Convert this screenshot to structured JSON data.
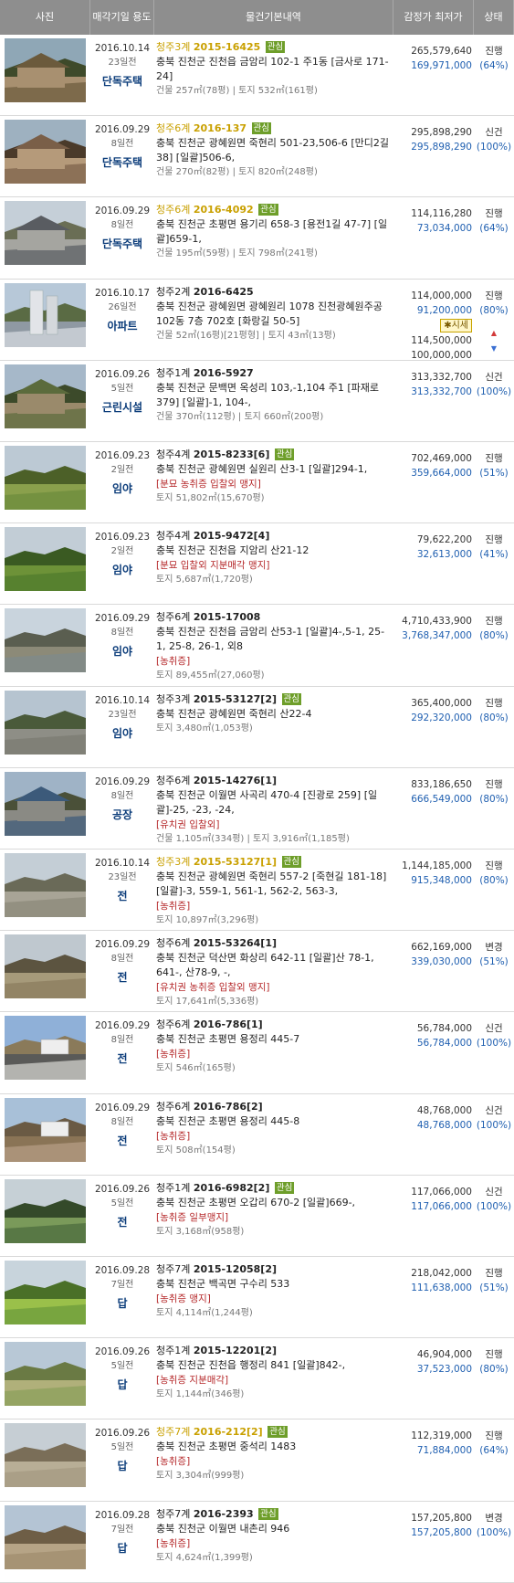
{
  "header": {
    "photo": "사진",
    "date": "매각기일 용도",
    "info": "물건기본내역",
    "price": "감정가 최저가",
    "status": "상태"
  },
  "items": [
    {
      "hl": true,
      "date": "2016.10.14",
      "ago": "23일전",
      "use": "단독주택",
      "court": "청주3계",
      "num": "2015-16425",
      "badge": "관심",
      "addr": "충북 진천군 진천읍 금암리 102-1 주1동 [금사로 171-24]",
      "tags": "",
      "area": "건물 257㎡(78평) | 토지 532㎡(161평)",
      "appraisal": "265,579,640",
      "minimum": "169,971,000",
      "status": "진행",
      "pct": "(64%)",
      "photo": "house"
    },
    {
      "hl": true,
      "date": "2016.09.29",
      "ago": "8일전",
      "use": "단독주택",
      "court": "청주6계",
      "num": "2016-137",
      "badge": "관심",
      "addr": "충북 진천군 광혜원면 죽현리 501-23,506-6 [만디2길 38] [일괄]506-6,",
      "tags": "",
      "area": "건물 270㎡(82평) | 토지 820㎡(248평)",
      "appraisal": "295,898,290",
      "minimum": "295,898,290",
      "status": "신건",
      "pct": "(100%)",
      "photo": "house2"
    },
    {
      "hl": true,
      "date": "2016.09.29",
      "ago": "8일전",
      "use": "단독주택",
      "court": "청주6계",
      "num": "2016-4092",
      "badge": "관심",
      "addr": "충북 진천군 초평면 용기리 658-3 [용전1길 47-7] [일괄]659-1,",
      "tags": "",
      "area": "건물 195㎡(59평) | 토지 798㎡(241평)",
      "appraisal": "114,116,280",
      "minimum": "73,034,000",
      "status": "진행",
      "pct": "(64%)",
      "photo": "house3"
    },
    {
      "hl": false,
      "date": "2016.10.17",
      "ago": "26일전",
      "use": "아파트",
      "court": "청주2계",
      "num": "2016-6425",
      "badge": "",
      "addr": "충북 진천군 광혜원면 광혜원리 1078 진천광혜원주공 102동 7층 702호 [화랑길 50-5]",
      "tags": "",
      "area": "건물 52㎡(16평)[21평형] | 토지 43㎡(13평)",
      "appraisal": "114,000,000",
      "minimum": "91,200,000",
      "status": "진행",
      "pct": "(80%)",
      "sise": "시세",
      "sise_hi": "114,500,000",
      "sise_lo": "100,000,000",
      "photo": "apt"
    },
    {
      "hl": false,
      "date": "2016.09.26",
      "ago": "5일전",
      "use": "근린시설",
      "court": "청주1계",
      "num": "2016-5927",
      "badge": "",
      "addr": "충북 진천군 문백면 옥성리 103,-1,104 주1 [파재로 379] [일괄]-1, 104-,",
      "tags": "",
      "area": "건물 370㎡(112평) | 토지 660㎡(200평)",
      "appraisal": "313,332,700",
      "minimum": "313,332,700",
      "status": "신건",
      "pct": "(100%)",
      "photo": "house4"
    },
    {
      "hl": false,
      "date": "2016.09.23",
      "ago": "2일전",
      "use": "임야",
      "court": "청주4계",
      "num": "2015-8233[6]",
      "badge": "관심",
      "addr": "충북 진천군 광혜원면 실원리 산3-1 [일괄]294-1,",
      "tags": "[분묘  농취증  입찰외  맹지]",
      "area": "토지 51,802㎡(15,670평)",
      "appraisal": "702,469,000",
      "minimum": "359,664,000",
      "status": "진행",
      "pct": "(51%)",
      "photo": "field"
    },
    {
      "hl": false,
      "date": "2016.09.23",
      "ago": "2일전",
      "use": "임야",
      "court": "청주4계",
      "num": "2015-9472[4]",
      "badge": "",
      "addr": "충북 진천군 진천읍 지암리 산21-12",
      "tags": "[분묘  입찰외  지분매각  맹지]",
      "area": "토지 5,687㎡(1,720평)",
      "appraisal": "79,622,200",
      "minimum": "32,613,000",
      "status": "진행",
      "pct": "(41%)",
      "photo": "field2"
    },
    {
      "hl": false,
      "date": "2016.09.29",
      "ago": "8일전",
      "use": "임야",
      "court": "청주6계",
      "num": "2015-17008",
      "badge": "",
      "addr": "충북 진천군 진천읍 금암리 산53-1 [일괄]4-,5-1, 25-1, 25-8, 26-1, 외8",
      "tags": "[농취증]",
      "area": "토지 89,455㎡(27,060평)",
      "appraisal": "4,710,433,900",
      "minimum": "3,768,347,000",
      "status": "진행",
      "pct": "(80%)",
      "photo": "mount"
    },
    {
      "hl": false,
      "date": "2016.10.14",
      "ago": "23일전",
      "use": "임야",
      "court": "청주3계",
      "num": "2015-53127[2]",
      "badge": "관심",
      "addr": "충북 진천군 광혜원면 죽현리 산22-4",
      "tags": "",
      "area": "토지 3,480㎡(1,053평)",
      "appraisal": "365,400,000",
      "minimum": "292,320,000",
      "status": "진행",
      "pct": "(80%)",
      "photo": "road"
    },
    {
      "hl": false,
      "date": "2016.09.29",
      "ago": "8일전",
      "use": "공장",
      "court": "청주6계",
      "num": "2015-14276[1]",
      "badge": "",
      "addr": "충북 진천군 이월면 사곡리 470-4 [진광로 259] [일괄]-25, -23, -24,",
      "tags": "[유치권  입찰외]",
      "area": "건물 1,105㎡(334평) | 토지 3,916㎡(1,185평)",
      "appraisal": "833,186,650",
      "minimum": "666,549,000",
      "status": "진행",
      "pct": "(80%)",
      "photo": "factory"
    },
    {
      "hl": true,
      "date": "2016.10.14",
      "ago": "23일전",
      "use": "전",
      "court": "청주3계",
      "num": "2015-53127[1]",
      "badge": "관심",
      "addr": "충북 진천군 광혜원면 죽현리 557-2 [죽현길 181-18] [일괄]-3, 559-1, 561-1, 562-2, 563-3,",
      "tags": "[농취증]",
      "area": "토지 10,897㎡(3,296평)",
      "appraisal": "1,144,185,000",
      "minimum": "915,348,000",
      "status": "진행",
      "pct": "(80%)",
      "photo": "road2"
    },
    {
      "hl": false,
      "date": "2016.09.29",
      "ago": "8일전",
      "use": "전",
      "court": "청주6계",
      "num": "2015-53264[1]",
      "badge": "",
      "addr": "충북 진천군 덕산면 화상리 642-11 [일괄]산 78-1, 641-, 산78-9, -,",
      "tags": "[유치권  농취증  입찰외  맹지]",
      "area": "토지 17,641㎡(5,336평)",
      "appraisal": "662,169,000",
      "minimum": "339,030,000",
      "status": "변경",
      "pct": "(51%)",
      "photo": "bush"
    },
    {
      "hl": false,
      "date": "2016.09.29",
      "ago": "8일전",
      "use": "전",
      "court": "청주6계",
      "num": "2016-786[1]",
      "badge": "",
      "addr": "충북 진천군 초평면 용정리 445-7",
      "tags": "[농취증]",
      "area": "토지 546㎡(165평)",
      "appraisal": "56,784,000",
      "minimum": "56,784,000",
      "status": "신건",
      "pct": "(100%)",
      "photo": "town"
    },
    {
      "hl": false,
      "date": "2016.09.29",
      "ago": "8일전",
      "use": "전",
      "court": "청주6계",
      "num": "2016-786[2]",
      "badge": "",
      "addr": "충북 진천군 초평면 용정리 445-8",
      "tags": "[농취증]",
      "area": "토지 508㎡(154평)",
      "appraisal": "48,768,000",
      "minimum": "48,768,000",
      "status": "신건",
      "pct": "(100%)",
      "photo": "town2"
    },
    {
      "hl": false,
      "date": "2016.09.26",
      "ago": "5일전",
      "use": "전",
      "court": "청주1계",
      "num": "2016-6982[2]",
      "badge": "관심",
      "addr": "충북 진천군 초평면 오갑리 670-2 [일괄]669-,",
      "tags": "[농취증  일부맹지]",
      "area": "토지 3,168㎡(958평)",
      "appraisal": "117,066,000",
      "minimum": "117,066,000",
      "status": "신건",
      "pct": "(100%)",
      "photo": "paddy"
    },
    {
      "hl": false,
      "date": "2016.09.28",
      "ago": "7일전",
      "use": "답",
      "court": "청주7계",
      "num": "2015-12058[2]",
      "badge": "",
      "addr": "충북 진천군 백곡면 구수리 533",
      "tags": "[농취증  맹지]",
      "area": "토지 4,114㎡(1,244평)",
      "appraisal": "218,042,000",
      "minimum": "111,638,000",
      "status": "진행",
      "pct": "(51%)",
      "photo": "green"
    },
    {
      "hl": false,
      "date": "2016.09.26",
      "ago": "5일전",
      "use": "답",
      "court": "청주1계",
      "num": "2015-12201[2]",
      "badge": "",
      "addr": "충북 진천군 진천읍 행정리 841 [일괄]842-,",
      "tags": "[농취증  지분매각]",
      "area": "토지 1,144㎡(346평)",
      "appraisal": "46,904,000",
      "minimum": "37,523,000",
      "status": "진행",
      "pct": "(80%)",
      "photo": "green2"
    },
    {
      "hl": true,
      "date": "2016.09.26",
      "ago": "5일전",
      "use": "답",
      "court": "청주7계",
      "num": "2016-212[2]",
      "badge": "관심",
      "addr": "충북 진천군 초평면 중석리 1483",
      "tags": "[농취증]",
      "area": "토지 3,304㎡(999평)",
      "appraisal": "112,319,000",
      "minimum": "71,884,000",
      "status": "진행",
      "pct": "(64%)",
      "photo": "dry"
    },
    {
      "hl": false,
      "date": "2016.09.28",
      "ago": "7일전",
      "use": "답",
      "court": "청주7계",
      "num": "2016-2393",
      "badge": "관심",
      "addr": "충북 진천군 이월면 내촌리 946",
      "tags": "[농취증]",
      "area": "토지 4,624㎡(1,399평)",
      "appraisal": "157,205,800",
      "minimum": "157,205,800",
      "status": "변경",
      "pct": "(100%)",
      "photo": "dry2"
    }
  ]
}
